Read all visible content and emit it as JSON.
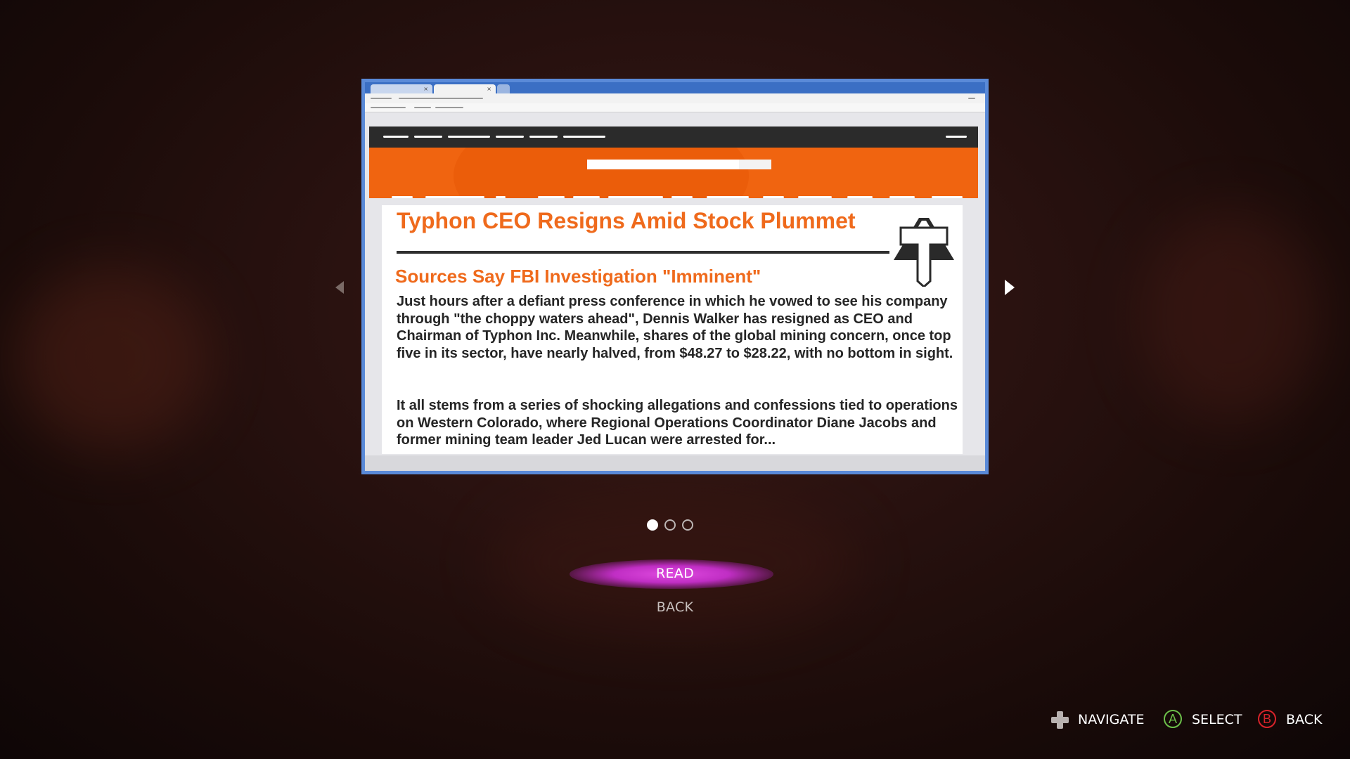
{
  "article": {
    "headline": "Typhon CEO Resigns Amid Stock Plummet",
    "subhead": "Sources Say FBI Investigation \"Imminent\"",
    "paragraph_1": "Just hours after a defiant press conference in which he vowed to see his company through \"the choppy waters ahead\", Dennis Walker has resigned as CEO and Chairman of Typhon Inc. Meanwhile, shares of the global mining concern, once top five in its sector, have nearly halved, from $48.27 to $28.22, with no bottom in sight.",
    "paragraph_2": "It all stems from a series of shocking allegations and confessions tied to operations on Western Colorado, where Regional Operations Coordinator Diane Jacobs and former mining team leader Jed Lucan were arrested for...",
    "logo_icon": "typhon-t-logo-icon"
  },
  "pagination": {
    "total": 3,
    "current": 1
  },
  "menu": {
    "read_label": "READ",
    "back_label": "BACK",
    "selected": "read"
  },
  "controls": {
    "navigate_label": "NAVIGATE",
    "select_label": "SELECT",
    "select_button": "A",
    "back_label": "BACK",
    "back_button": "B"
  },
  "colors": {
    "accent_orange": "#ef6a1c",
    "highlight_magenta": "#d23cd6",
    "button_a": "#6cc04a",
    "button_b": "#d8232a",
    "frame_blue": "#5a8ad8"
  }
}
